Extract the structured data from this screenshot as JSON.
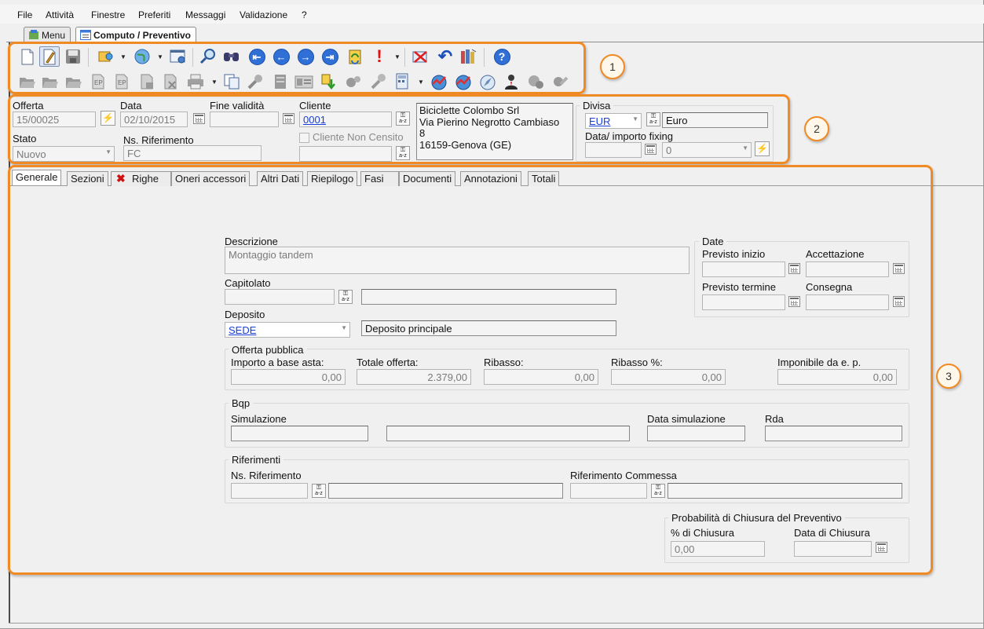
{
  "menubar": {
    "items": [
      "File",
      "Attività",
      "Finestre",
      "Preferiti",
      "Messaggi",
      "Validazione",
      "?"
    ]
  },
  "doc_tabs": [
    {
      "label": "Menu"
    },
    {
      "label": "Computo / Preventivo"
    }
  ],
  "toolbar_icons": {
    "row1": [
      "new-document-icon",
      "edit-icon",
      "save-icon",
      "add-dropdown-icon",
      "globe-dropdown-icon",
      "settings-window-icon",
      "search-icon",
      "binoculars-icon",
      "first-record-icon",
      "previous-record-icon",
      "next-record-icon",
      "last-record-icon",
      "refresh-icon",
      "alert-dropdown-icon",
      "delete-icon",
      "undo-icon",
      "books-icon",
      "help-icon"
    ],
    "row2": [
      "open-folder-icon",
      "open-folder-icon",
      "open-folder-icon",
      "document-ep-icon",
      "document-ep-icon",
      "document-stamp-icon",
      "document-cancel-icon",
      "print-dropdown-icon",
      "copy-icon",
      "tools-icon",
      "ledger-icon",
      "image-list-icon",
      "export-icon",
      "gears-icon",
      "wrench-icon",
      "calculator-dropdown-icon",
      "globe-chart-icon",
      "globe-chart-icon",
      "globe-compass-icon",
      "person-icon",
      "info-gear-icon",
      "gear-wrench-icon"
    ]
  },
  "header": {
    "offerta": {
      "label": "Offerta",
      "value": "15/00025"
    },
    "data": {
      "label": "Data",
      "value": "02/10/2015"
    },
    "fine_validita": {
      "label": "Fine validità",
      "value": ""
    },
    "cliente": {
      "label": "Cliente",
      "value": "0001"
    },
    "cliente_non_censito": {
      "label": "Cliente Non Censito",
      "checked": false
    },
    "indirizzo": {
      "line1": "Biciclette Colombo Srl",
      "line2": "Via Pierino Negrotto Cambiaso",
      "line3": "8",
      "line4": "16159-Genova (GE)"
    },
    "divisa": {
      "label": "Divisa",
      "code": "EUR",
      "name": "Euro"
    },
    "fixing": {
      "label": "Data/ importo fixing",
      "value": "0"
    },
    "stato": {
      "label": "Stato",
      "value": "Nuovo"
    },
    "ns_riferimento": {
      "label": "Ns. Riferimento",
      "value": "FC"
    }
  },
  "section_tabs": [
    "Generale",
    "Sezioni",
    "Righe",
    "Oneri accessori",
    "Altri Dati",
    "Riepilogo",
    "Fasi",
    "Documenti",
    "Annotazioni",
    "Totali"
  ],
  "generale": {
    "descrizione": {
      "label": "Descrizione",
      "value": "Montaggio tandem"
    },
    "capitolato": {
      "label": "Capitolato",
      "value": ""
    },
    "deposito": {
      "label": "Deposito",
      "code": "SEDE",
      "name": "Deposito principale"
    },
    "date_group": {
      "title": "Date",
      "previsto_inizio": "Previsto inizio",
      "accettazione": "Accettazione",
      "previsto_termine": "Previsto termine",
      "consegna": "Consegna"
    },
    "offerta_pubblica": {
      "title": "Offerta pubblica",
      "importo_base_label": "Importo a base asta:",
      "importo_base": "0,00",
      "totale_label": "Totale offerta:",
      "totale": "2.379,00",
      "ribasso_label": "Ribasso:",
      "ribasso": "0,00",
      "ribasso_pct_label": "Ribasso %:",
      "ribasso_pct": "0,00",
      "imponibile_label": "Imponibile da e. p.",
      "imponibile": "0,00"
    },
    "bqp": {
      "title": "Bqp",
      "simulazione": "Simulazione",
      "data_simulazione": "Data simulazione",
      "rda": "Rda"
    },
    "riferimenti": {
      "title": "Riferimenti",
      "ns_riferimento": "Ns. Riferimento",
      "rif_commessa": "Riferimento Commessa"
    },
    "probabilita": {
      "title": "Probabilità di Chiusura del Preventivo",
      "pct_label": "% di Chiusura",
      "pct_value": "0,00",
      "data_label": "Data di Chiusura"
    }
  },
  "callouts": [
    "1",
    "2",
    "3"
  ],
  "colors": {
    "callout": "#f08a24",
    "link": "#1a3fd8",
    "window": "#f0f0f0"
  }
}
